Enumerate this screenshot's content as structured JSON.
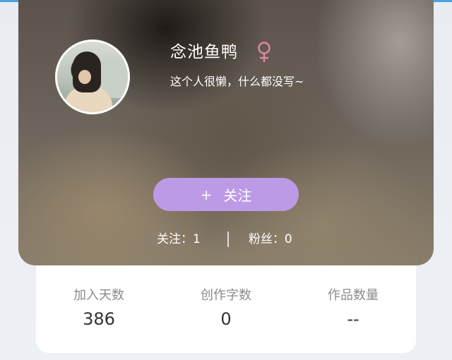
{
  "profile": {
    "username": "念池鱼鸭",
    "gender_symbol": "♀",
    "bio": "这个人很懒，什么都没写~",
    "follow_button": {
      "icon": "+",
      "label": "关注"
    },
    "following": {
      "label": "关注：",
      "value": "1"
    },
    "followers": {
      "label": "粉丝：",
      "value": "0"
    }
  },
  "stats": [
    {
      "label": "加入天数",
      "value": "386"
    },
    {
      "label": "创作字数",
      "value": "0"
    },
    {
      "label": "作品数量",
      "value": "--"
    }
  ],
  "colors": {
    "accent_purple": "#bd9ae6",
    "gender_pink": "#e28aa0",
    "top_strip_blue": "#4aa3d8"
  }
}
